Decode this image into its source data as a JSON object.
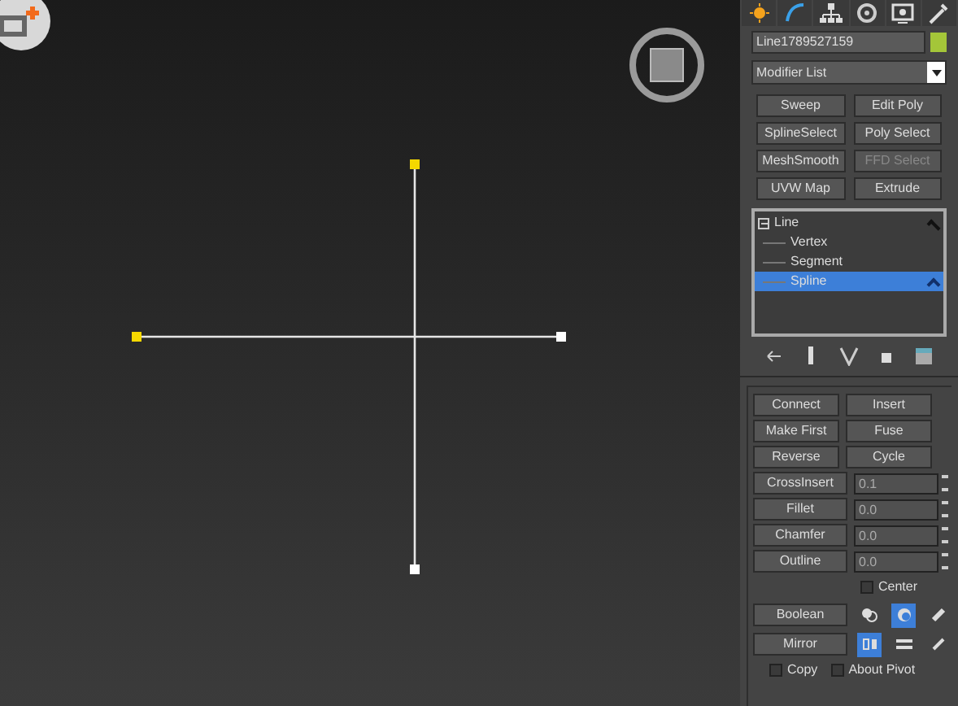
{
  "command_panel": {
    "object_name": "Line1789527159",
    "modifier_list": {
      "value": "Modifier List"
    },
    "modifier_buttons": [
      {
        "label": "Sweep",
        "disabled": false
      },
      {
        "label": "Edit Poly",
        "disabled": false
      },
      {
        "label": "SplineSelect",
        "disabled": false
      },
      {
        "label": "Poly Select",
        "disabled": false
      },
      {
        "label": "MeshSmooth",
        "disabled": false
      },
      {
        "label": "FFD Select",
        "disabled": true
      },
      {
        "label": "UVW Map",
        "disabled": false
      },
      {
        "label": "Extrude",
        "disabled": false
      }
    ],
    "stack": [
      {
        "label": "Line",
        "expanded": true,
        "children": [
          {
            "label": "Vertex",
            "selected": false
          },
          {
            "label": "Segment",
            "selected": false
          },
          {
            "label": "Spline",
            "selected": true
          }
        ]
      }
    ],
    "geometry": [
      {
        "kind": "buttons",
        "buttons": [
          {
            "label": "Connect",
            "disabled": false
          },
          {
            "label": "Insert",
            "disabled": false
          }
        ]
      },
      {
        "kind": "buttons",
        "buttons": [
          {
            "label": "Make First",
            "disabled": false
          },
          {
            "label": "Fuse",
            "disabled": false
          }
        ]
      },
      {
        "kind": "buttons",
        "buttons": [
          {
            "label": "Reverse",
            "disabled": false
          },
          {
            "label": "Cycle",
            "disabled": false
          }
        ]
      },
      {
        "kind": "spinner",
        "label": "CrossInsert",
        "value": "0.1"
      },
      {
        "kind": "spinner",
        "label": "Fillet",
        "value": "0.0"
      },
      {
        "kind": "spinner",
        "label": "Chamfer",
        "value": "0.0"
      },
      {
        "kind": "spinner",
        "label": "Outline",
        "value": "0.0"
      },
      {
        "kind": "checkbox",
        "label": "Center",
        "checked": false
      },
      {
        "kind": "icons",
        "label": "Boolean",
        "icons": [
          {
            "selected": false
          },
          {
            "selected": true
          },
          {
            "selected": false
          }
        ]
      },
      {
        "kind": "icons",
        "label": "Mirror",
        "icons": [
          {
            "selected": true
          },
          {
            "selected": false
          },
          {
            "selected": false
          }
        ]
      },
      {
        "kind": "checkboxes",
        "boxes": [
          {
            "label": "Copy",
            "checked": false
          },
          {
            "label": "About Pivot",
            "checked": false
          }
        ]
      }
    ]
  }
}
